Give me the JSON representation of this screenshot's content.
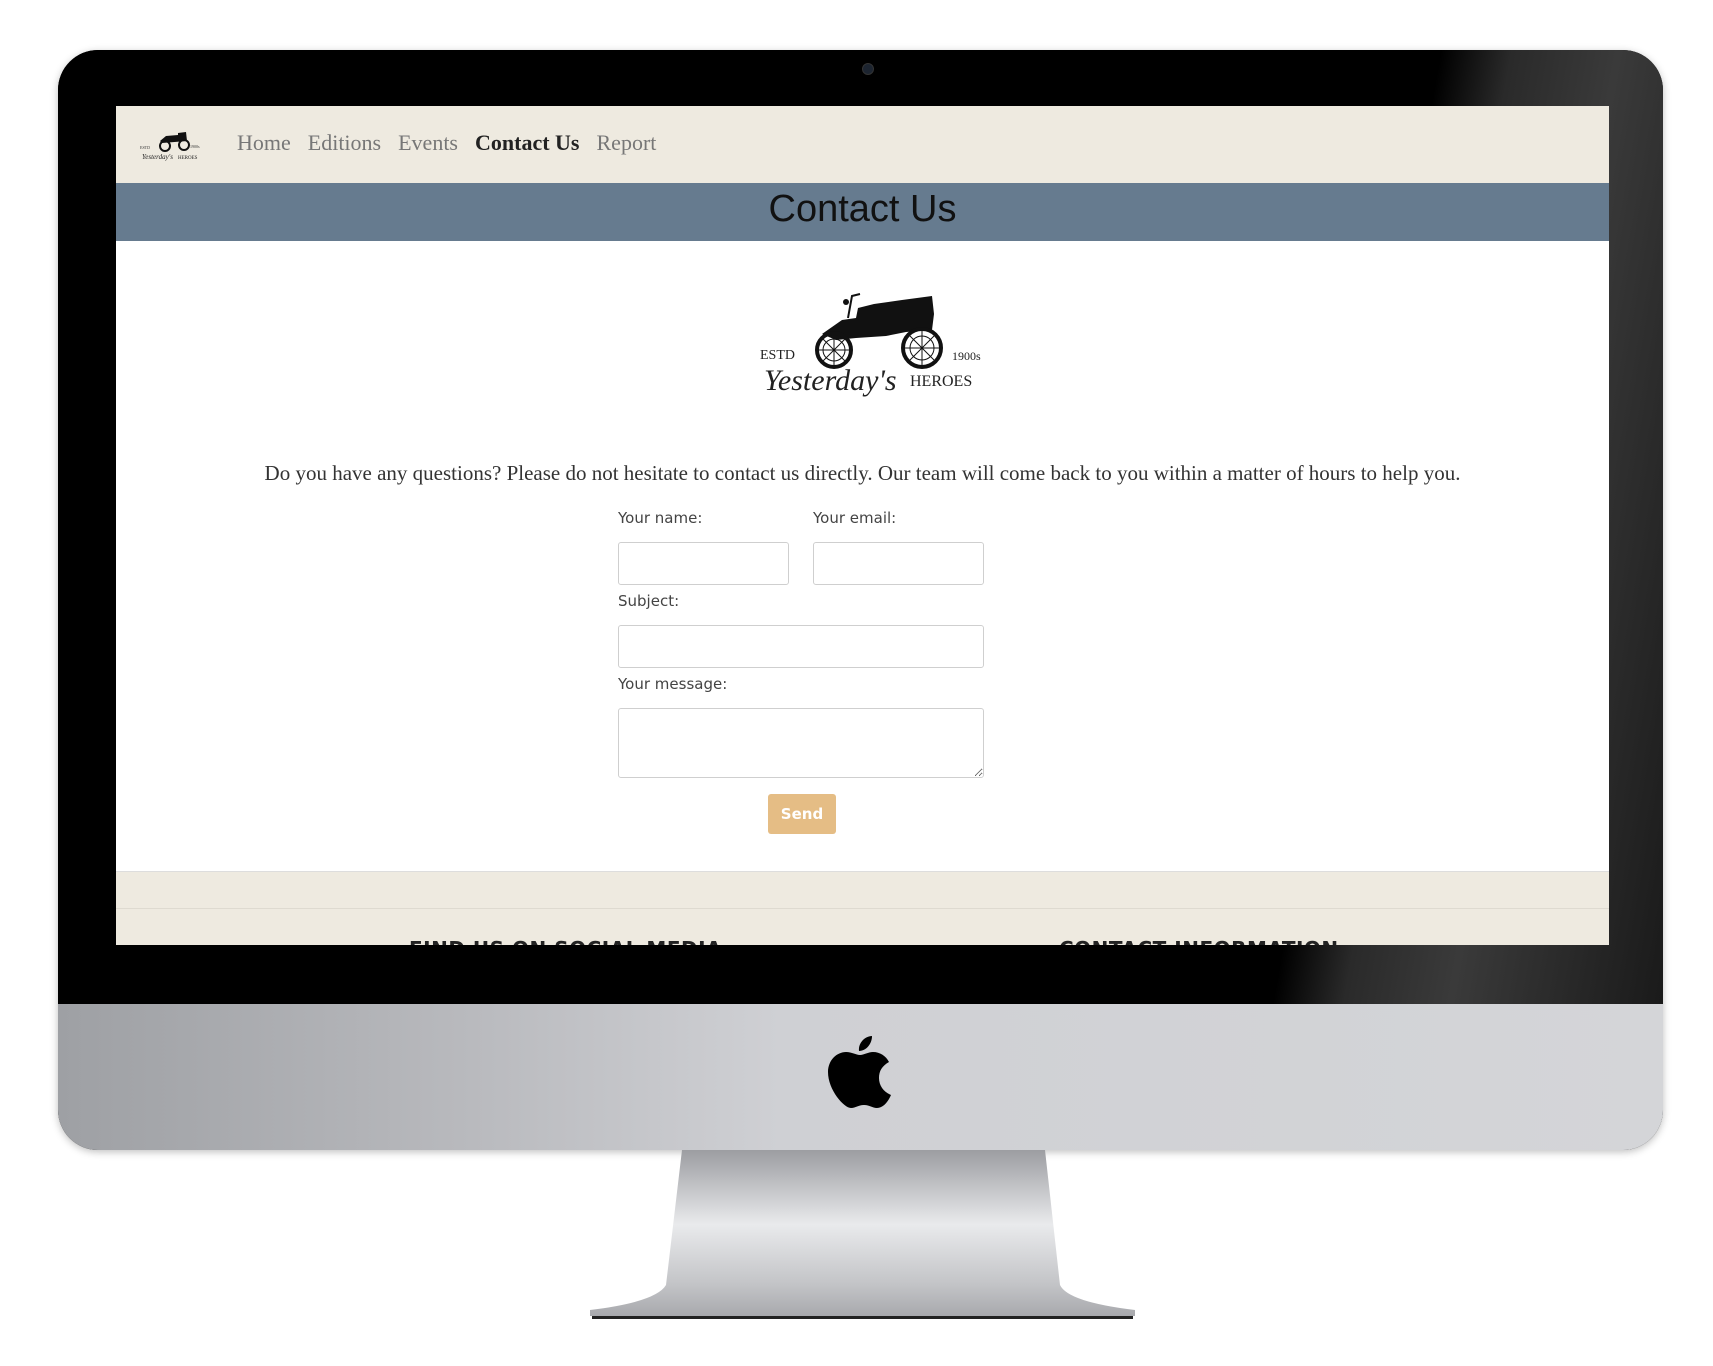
{
  "navbar": {
    "logo_text": "Yesterday's Heroes",
    "links": [
      {
        "label": "Home",
        "active": false
      },
      {
        "label": "Editions",
        "active": false
      },
      {
        "label": "Events",
        "active": false
      },
      {
        "label": "Contact Us",
        "active": true
      },
      {
        "label": "Report",
        "active": false
      }
    ]
  },
  "page": {
    "title": "Contact Us",
    "logo": {
      "estd": "ESTD",
      "year": "1900s",
      "script": "Yesterday's",
      "caps": "HEROES"
    },
    "intro": "Do you have any questions? Please do not hesitate to contact us directly. Our team will come back to you within a matter of hours to help you."
  },
  "form": {
    "name_label": "Your name:",
    "name_value": "",
    "email_label": "Your email:",
    "email_value": "",
    "subject_label": "Subject:",
    "subject_value": "",
    "message_label": "Your message:",
    "message_value": "",
    "send_label": "Send"
  },
  "footer": {
    "social_heading": "FIND US ON SOCIAL MEDIA",
    "contact_heading": "CONTACT INFORMATION"
  },
  "colors": {
    "navbar_bg": "#eeeae0",
    "title_band": "#667b8f",
    "send_button": "#e5bd85"
  }
}
